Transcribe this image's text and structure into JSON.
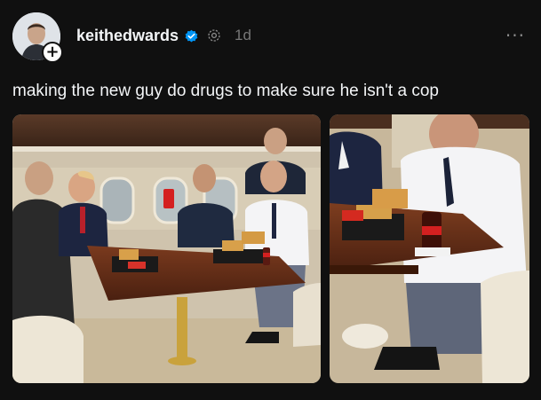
{
  "post": {
    "username": "keithedwards",
    "timestamp": "1d",
    "more_label": "···",
    "follow_label": "+",
    "caption": "making the new guy do drugs to make sure he isn't a cop"
  },
  "icons": {
    "verified": "verified-badge-icon",
    "thread": "thread-icon",
    "more": "more-options-icon"
  },
  "colors": {
    "background": "#101010",
    "text": "#f3f5f7",
    "muted": "#777777",
    "verified_blue": "#0095f6"
  }
}
